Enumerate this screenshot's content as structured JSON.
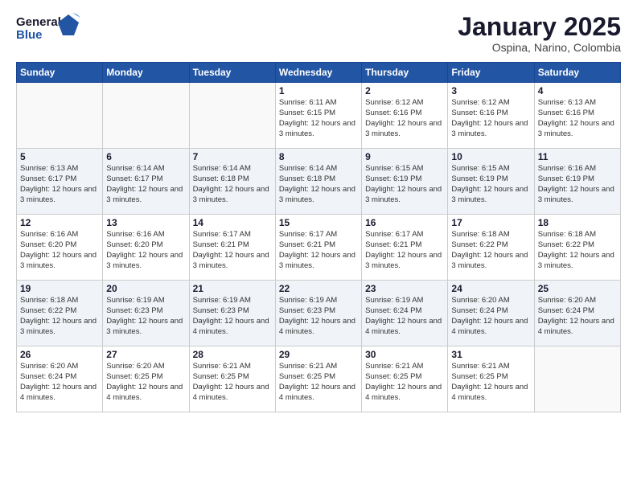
{
  "logo": {
    "line1": "General",
    "line2": "Blue"
  },
  "header": {
    "title": "January 2025",
    "subtitle": "Ospina, Narino, Colombia"
  },
  "weekdays": [
    "Sunday",
    "Monday",
    "Tuesday",
    "Wednesday",
    "Thursday",
    "Friday",
    "Saturday"
  ],
  "weeks": [
    [
      {
        "num": "",
        "info": ""
      },
      {
        "num": "",
        "info": ""
      },
      {
        "num": "",
        "info": ""
      },
      {
        "num": "1",
        "info": "Sunrise: 6:11 AM\nSunset: 6:15 PM\nDaylight: 12 hours\nand 3 minutes."
      },
      {
        "num": "2",
        "info": "Sunrise: 6:12 AM\nSunset: 6:16 PM\nDaylight: 12 hours\nand 3 minutes."
      },
      {
        "num": "3",
        "info": "Sunrise: 6:12 AM\nSunset: 6:16 PM\nDaylight: 12 hours\nand 3 minutes."
      },
      {
        "num": "4",
        "info": "Sunrise: 6:13 AM\nSunset: 6:16 PM\nDaylight: 12 hours\nand 3 minutes."
      }
    ],
    [
      {
        "num": "5",
        "info": "Sunrise: 6:13 AM\nSunset: 6:17 PM\nDaylight: 12 hours\nand 3 minutes."
      },
      {
        "num": "6",
        "info": "Sunrise: 6:14 AM\nSunset: 6:17 PM\nDaylight: 12 hours\nand 3 minutes."
      },
      {
        "num": "7",
        "info": "Sunrise: 6:14 AM\nSunset: 6:18 PM\nDaylight: 12 hours\nand 3 minutes."
      },
      {
        "num": "8",
        "info": "Sunrise: 6:14 AM\nSunset: 6:18 PM\nDaylight: 12 hours\nand 3 minutes."
      },
      {
        "num": "9",
        "info": "Sunrise: 6:15 AM\nSunset: 6:19 PM\nDaylight: 12 hours\nand 3 minutes."
      },
      {
        "num": "10",
        "info": "Sunrise: 6:15 AM\nSunset: 6:19 PM\nDaylight: 12 hours\nand 3 minutes."
      },
      {
        "num": "11",
        "info": "Sunrise: 6:16 AM\nSunset: 6:19 PM\nDaylight: 12 hours\nand 3 minutes."
      }
    ],
    [
      {
        "num": "12",
        "info": "Sunrise: 6:16 AM\nSunset: 6:20 PM\nDaylight: 12 hours\nand 3 minutes."
      },
      {
        "num": "13",
        "info": "Sunrise: 6:16 AM\nSunset: 6:20 PM\nDaylight: 12 hours\nand 3 minutes."
      },
      {
        "num": "14",
        "info": "Sunrise: 6:17 AM\nSunset: 6:21 PM\nDaylight: 12 hours\nand 3 minutes."
      },
      {
        "num": "15",
        "info": "Sunrise: 6:17 AM\nSunset: 6:21 PM\nDaylight: 12 hours\nand 3 minutes."
      },
      {
        "num": "16",
        "info": "Sunrise: 6:17 AM\nSunset: 6:21 PM\nDaylight: 12 hours\nand 3 minutes."
      },
      {
        "num": "17",
        "info": "Sunrise: 6:18 AM\nSunset: 6:22 PM\nDaylight: 12 hours\nand 3 minutes."
      },
      {
        "num": "18",
        "info": "Sunrise: 6:18 AM\nSunset: 6:22 PM\nDaylight: 12 hours\nand 3 minutes."
      }
    ],
    [
      {
        "num": "19",
        "info": "Sunrise: 6:18 AM\nSunset: 6:22 PM\nDaylight: 12 hours\nand 3 minutes."
      },
      {
        "num": "20",
        "info": "Sunrise: 6:19 AM\nSunset: 6:23 PM\nDaylight: 12 hours\nand 3 minutes."
      },
      {
        "num": "21",
        "info": "Sunrise: 6:19 AM\nSunset: 6:23 PM\nDaylight: 12 hours\nand 4 minutes."
      },
      {
        "num": "22",
        "info": "Sunrise: 6:19 AM\nSunset: 6:23 PM\nDaylight: 12 hours\nand 4 minutes."
      },
      {
        "num": "23",
        "info": "Sunrise: 6:19 AM\nSunset: 6:24 PM\nDaylight: 12 hours\nand 4 minutes."
      },
      {
        "num": "24",
        "info": "Sunrise: 6:20 AM\nSunset: 6:24 PM\nDaylight: 12 hours\nand 4 minutes."
      },
      {
        "num": "25",
        "info": "Sunrise: 6:20 AM\nSunset: 6:24 PM\nDaylight: 12 hours\nand 4 minutes."
      }
    ],
    [
      {
        "num": "26",
        "info": "Sunrise: 6:20 AM\nSunset: 6:24 PM\nDaylight: 12 hours\nand 4 minutes."
      },
      {
        "num": "27",
        "info": "Sunrise: 6:20 AM\nSunset: 6:25 PM\nDaylight: 12 hours\nand 4 minutes."
      },
      {
        "num": "28",
        "info": "Sunrise: 6:21 AM\nSunset: 6:25 PM\nDaylight: 12 hours\nand 4 minutes."
      },
      {
        "num": "29",
        "info": "Sunrise: 6:21 AM\nSunset: 6:25 PM\nDaylight: 12 hours\nand 4 minutes."
      },
      {
        "num": "30",
        "info": "Sunrise: 6:21 AM\nSunset: 6:25 PM\nDaylight: 12 hours\nand 4 minutes."
      },
      {
        "num": "31",
        "info": "Sunrise: 6:21 AM\nSunset: 6:25 PM\nDaylight: 12 hours\nand 4 minutes."
      },
      {
        "num": "",
        "info": ""
      }
    ]
  ]
}
